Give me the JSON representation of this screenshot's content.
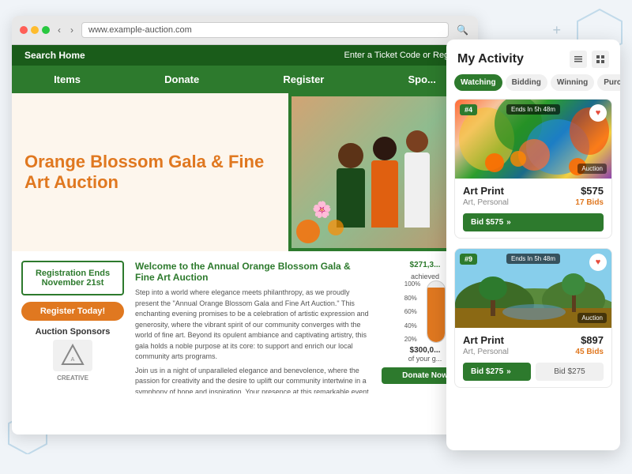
{
  "page": {
    "background_color": "#e8eff5"
  },
  "browser": {
    "address": "www.example-auction.com",
    "dots": [
      "red",
      "yellow",
      "green"
    ]
  },
  "site": {
    "top_bar": {
      "left": "Search Home",
      "right": "Enter a Ticket Code or Register"
    },
    "nav": {
      "items": [
        "Items",
        "Donate",
        "Register",
        "Spo..."
      ]
    },
    "hero": {
      "title": "Orange Blossom Gala & Fine Art Auction"
    },
    "registration": {
      "label": "Registration Ends",
      "date": "November 21st",
      "button": "Register Today!"
    },
    "sponsors": {
      "label": "Auction Sponsors",
      "name": "CREATIVE"
    },
    "welcome": {
      "title": "Welcome to the Annual Orange Blossom Gala & Fine Art Auction",
      "text1": "Step into a world where elegance meets philanthropy, as we proudly present the \"Annual Orange Blossom Gala and Fine Art Auction.\" This enchanting evening promises to be a celebration of artistic expression and generosity, where the vibrant spirit of our community converges with the world of fine art. Beyond its opulent ambiance and captivating artistry, this gala holds a noble purpose at its core: to support and enrich our local community arts programs.",
      "text2": "Join us in a night of unparalleled elegance and benevolence, where the passion for creativity and the desire to uplift our community intertwine in a symphony of hope and inspiration. Your presence at this remarkable event is not just a celebration of art; it is a testament to your commitment to nurturing the cultural heart of our community. Welcome to the Annual Orange Blossom Gala and Fine Art Auction, where every bid is a brushstroke in the canvas of a brighter future for our community's artistic aspirations."
    },
    "fundraising": {
      "raised": "$271,3...",
      "goal": "$300,0...",
      "percent": "90",
      "percent_label": "of your g...",
      "donate_button": "Donate Now",
      "therm_levels": [
        "100%",
        "80%",
        "60%",
        "40%",
        "20%"
      ]
    }
  },
  "activity_panel": {
    "title": "My Activity",
    "tabs": [
      {
        "label": "Watching",
        "active": true
      },
      {
        "label": "Bidding",
        "active": false
      },
      {
        "label": "Winning",
        "active": false
      },
      {
        "label": "Purchases",
        "active": false
      }
    ],
    "cards": [
      {
        "id": "#4",
        "timer": "Ends In 5h 48m",
        "name": "Art Print",
        "category": "Art, Personal",
        "price": "$575",
        "bids": "17 Bids",
        "badge_label": "Auction",
        "bid_button": "Bid $575",
        "bid_arrows": "»"
      },
      {
        "id": "#9",
        "timer": "Ends In 5h 48m",
        "name": "Art Print",
        "category": "Art, Personal",
        "price": "$897",
        "bids": "45 Bids",
        "badge_label": "Auction",
        "bid_primary_button": "Bid $275",
        "bid_primary_arrows": "»",
        "bid_secondary_button": "Bid $275"
      }
    ],
    "view_icons": [
      "list",
      "grid"
    ]
  }
}
